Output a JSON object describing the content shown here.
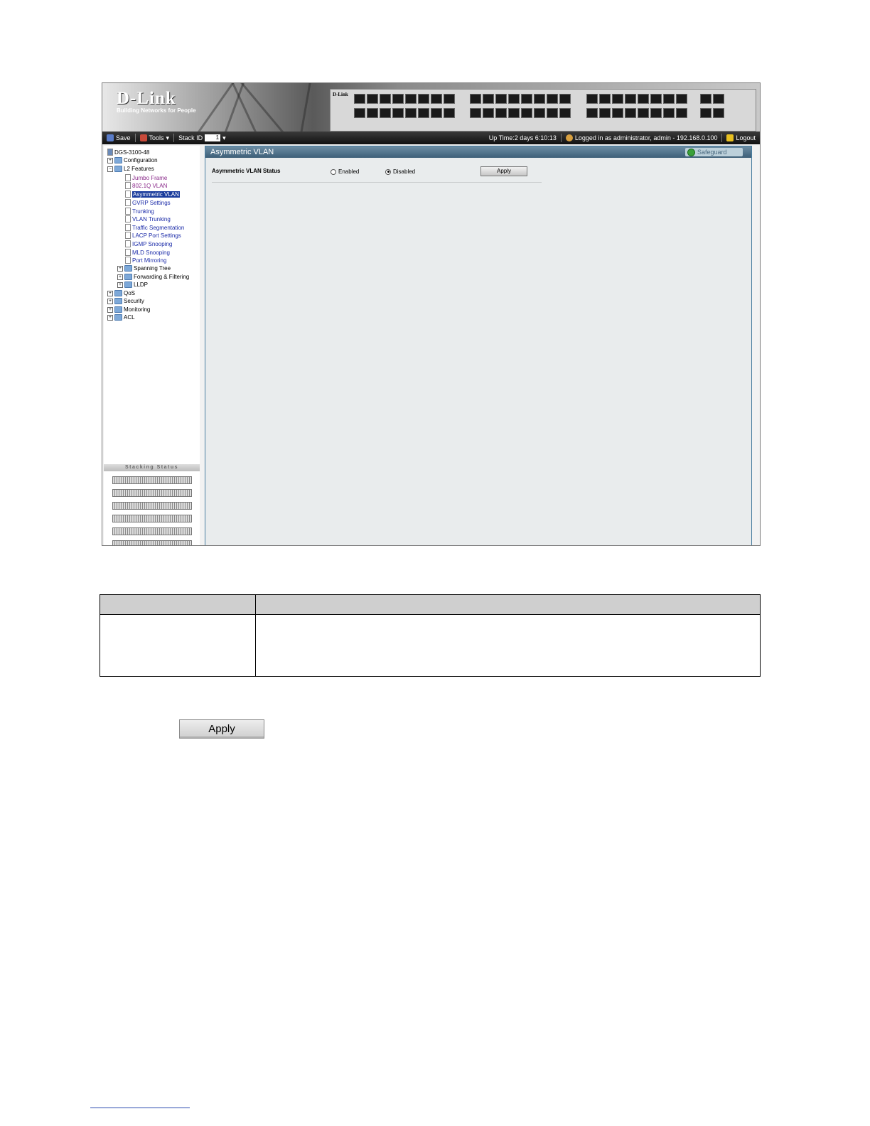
{
  "banner": {
    "brand": "D-Link",
    "tagline": "Building Networks for People",
    "panel_logo": "D-Link"
  },
  "toolbar": {
    "save_label": "Save",
    "tools_label": "Tools",
    "stack_id_label": "Stack ID",
    "stack_id_value": "1",
    "uptime": "Up Time:2 days 6:10:13",
    "login_info": "Logged in as administrator, admin - 192.168.0.100",
    "logout_label": "Logout"
  },
  "tree": {
    "root": "DGS-3100-48",
    "items": [
      {
        "label": "Configuration"
      },
      {
        "label": "L2 Features"
      },
      {
        "label": "Jumbo Frame"
      },
      {
        "label": "802.1Q VLAN"
      },
      {
        "label": "Asymmetric VLAN"
      },
      {
        "label": "GVRP Settings"
      },
      {
        "label": "Trunking"
      },
      {
        "label": "VLAN Trunking"
      },
      {
        "label": "Traffic Segmentation"
      },
      {
        "label": "LACP Port Settings"
      },
      {
        "label": "IGMP Snooping"
      },
      {
        "label": "MLD Snooping"
      },
      {
        "label": "Port Mirroring"
      },
      {
        "label": "Spanning Tree"
      },
      {
        "label": "Forwarding & Filtering"
      },
      {
        "label": "LLDP"
      },
      {
        "label": "QoS"
      },
      {
        "label": "Security"
      },
      {
        "label": "Monitoring"
      },
      {
        "label": "ACL"
      }
    ]
  },
  "stacking": {
    "title": "Stacking Status",
    "unit_count": 6
  },
  "content": {
    "title": "Asymmetric VLAN",
    "safeguard_label": "Safeguard",
    "status_label": "Asymmetric VLAN Status",
    "enabled_label": "Enabled",
    "disabled_label": "Disabled",
    "selected": "Disabled",
    "apply_label": "Apply"
  },
  "doc": {
    "apply_label": "Apply"
  },
  "colors": {
    "title_bar": "#3d5f78",
    "selection": "#1a3c9c",
    "link": "#1a2aa8"
  }
}
